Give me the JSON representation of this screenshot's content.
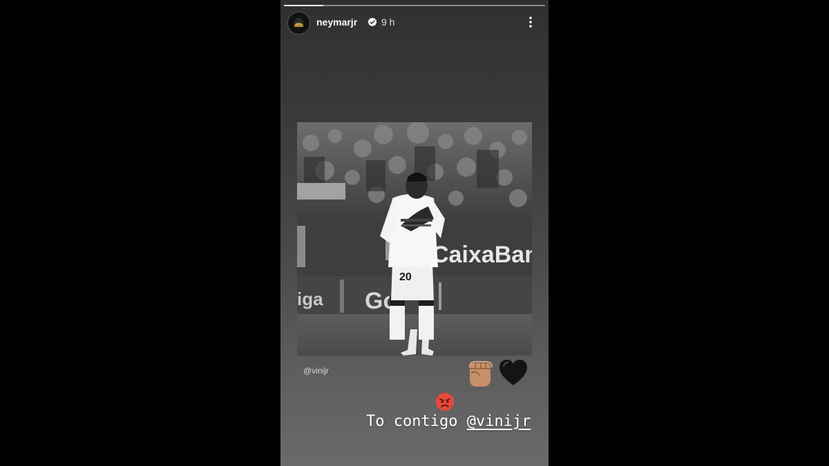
{
  "story": {
    "progress": 0.15,
    "user": {
      "username": "neymarjr",
      "verified": true,
      "time": "9 h"
    },
    "photo": {
      "tag": "@vinijr",
      "board_text_1": "CaixaBank",
      "board_text_2": "Go",
      "board_text_3": "iga",
      "jersey_number": "20"
    },
    "caption": {
      "text": "To contigo ",
      "mention": "@vinijr"
    },
    "stickers": [
      "raised-fist-emoji",
      "black-heart-emoji",
      "angry-face-emoji"
    ]
  }
}
